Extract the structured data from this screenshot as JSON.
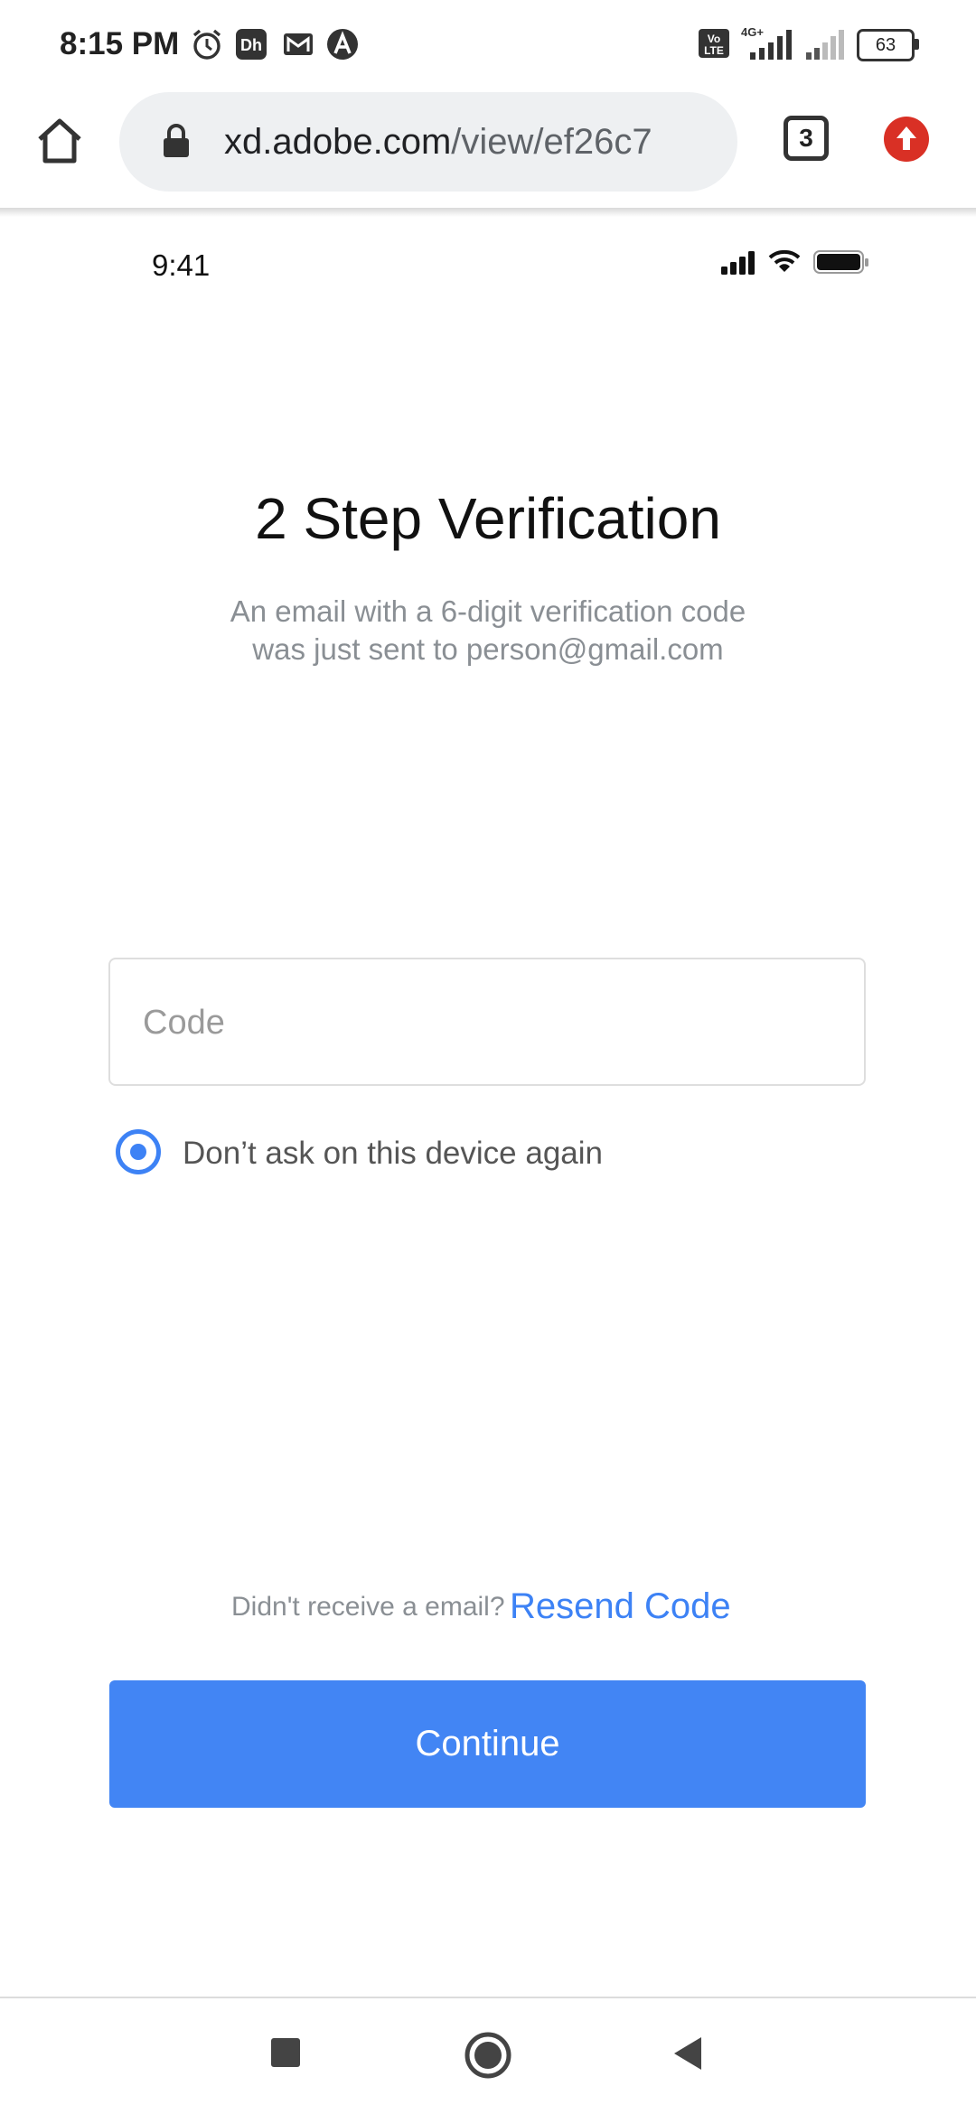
{
  "status_bar": {
    "time": "8:15 PM",
    "network_label": "4G+",
    "volte_label": "Vo LTE",
    "battery": "63",
    "icons": [
      "alarm-icon",
      "dh-app-icon",
      "gmail-icon",
      "app-a-icon",
      "volte-icon",
      "signal-icon",
      "signal-weak-icon",
      "battery-icon"
    ]
  },
  "browser": {
    "url_host": "xd.adobe.com",
    "url_path": "/view/ef26c7",
    "tabs_count": "3",
    "icons": [
      "home-icon",
      "lock-icon",
      "tabs-icon",
      "update-icon"
    ],
    "update_color": "#d93025"
  },
  "mock_status": {
    "time": "9:41"
  },
  "content": {
    "title": "2 Step Verification",
    "subtitle_line1": "An email with a 6-digit verification code",
    "subtitle_line2": "was just sent to person@gmail.com",
    "code_placeholder": "Code",
    "remember_label": "Don’t ask on this device again",
    "remember_checked": true,
    "resend_question": "Didn't receive a email?",
    "resend_link": "Resend Code",
    "continue_label": "Continue"
  },
  "colors": {
    "accent": "#4285f4",
    "link": "#3d82f5",
    "muted": "#8a8f94"
  },
  "nav_bar": {
    "icons": [
      "recents-square-icon",
      "home-circle-icon",
      "back-triangle-icon"
    ]
  }
}
